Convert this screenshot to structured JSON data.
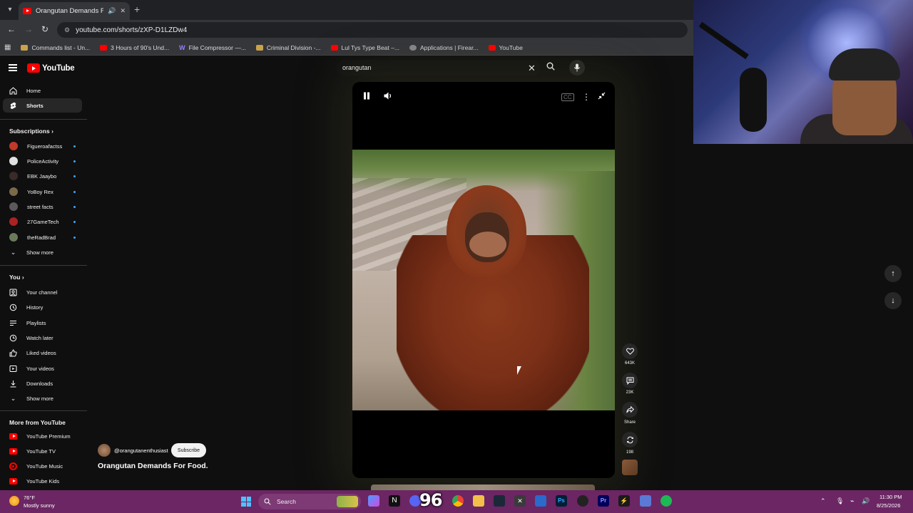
{
  "browser": {
    "tab_title": "Orangutan Demands For Fo",
    "url": "youtube.com/shorts/zXP-D1LZDw4",
    "bookmarks": [
      {
        "label": "Commands list - Un..."
      },
      {
        "label": "3 Hours of 90's Und..."
      },
      {
        "label": "File Compressor —..."
      },
      {
        "label": "Criminal Division -..."
      },
      {
        "label": "Lul Tys Type Beat –..."
      },
      {
        "label": "Applications | Firear..."
      },
      {
        "label": "YouTube"
      }
    ]
  },
  "youtube": {
    "logo_text": "YouTube",
    "search_value": "orangutan"
  },
  "sidebar": {
    "main": [
      {
        "label": "Home",
        "icon": "home-icon"
      },
      {
        "label": "Shorts",
        "icon": "shorts-icon"
      }
    ],
    "subscriptions_heading": "Subscriptions",
    "subscriptions": [
      {
        "label": "Figueroafactss",
        "color": "#c0392b"
      },
      {
        "label": "PoliceActivity",
        "color": "#e0e0e0"
      },
      {
        "label": "EBK Jaaybo",
        "color": "#3a2a2a"
      },
      {
        "label": "YoBoy Rex",
        "color": "#7a6a4a"
      },
      {
        "label": "street facts",
        "color": "#5a5a5a"
      },
      {
        "label": "27GameTech",
        "color": "#aa2222"
      },
      {
        "label": "theRadBrad",
        "color": "#6a7a5a"
      }
    ],
    "show_more_1": "Show more",
    "you_heading": "You",
    "you": [
      {
        "label": "Your channel",
        "icon": "channel-icon"
      },
      {
        "label": "History",
        "icon": "history-icon"
      },
      {
        "label": "Playlists",
        "icon": "playlists-icon"
      },
      {
        "label": "Watch later",
        "icon": "watch-later-icon"
      },
      {
        "label": "Liked videos",
        "icon": "like-icon"
      },
      {
        "label": "Your videos",
        "icon": "videos-icon"
      },
      {
        "label": "Downloads",
        "icon": "download-icon"
      }
    ],
    "show_more_2": "Show more",
    "more_heading": "More from YouTube",
    "more": [
      {
        "label": "YouTube Premium"
      },
      {
        "label": "YouTube TV"
      },
      {
        "label": "YouTube Music"
      },
      {
        "label": "YouTube Kids"
      }
    ]
  },
  "short": {
    "channel": "@orangutanenthusiast",
    "subscribe_label": "Subscribe",
    "title": "Orangutan Demands For Food.",
    "likes": "643K",
    "comments": "23K",
    "share": "Share",
    "remixes": "198"
  },
  "taskbar": {
    "temperature": "76°F",
    "condition": "Mostly sunny",
    "search_label": "Search",
    "overlay_number": "96",
    "time": "11:30 PM",
    "date": "8/25/2026"
  }
}
